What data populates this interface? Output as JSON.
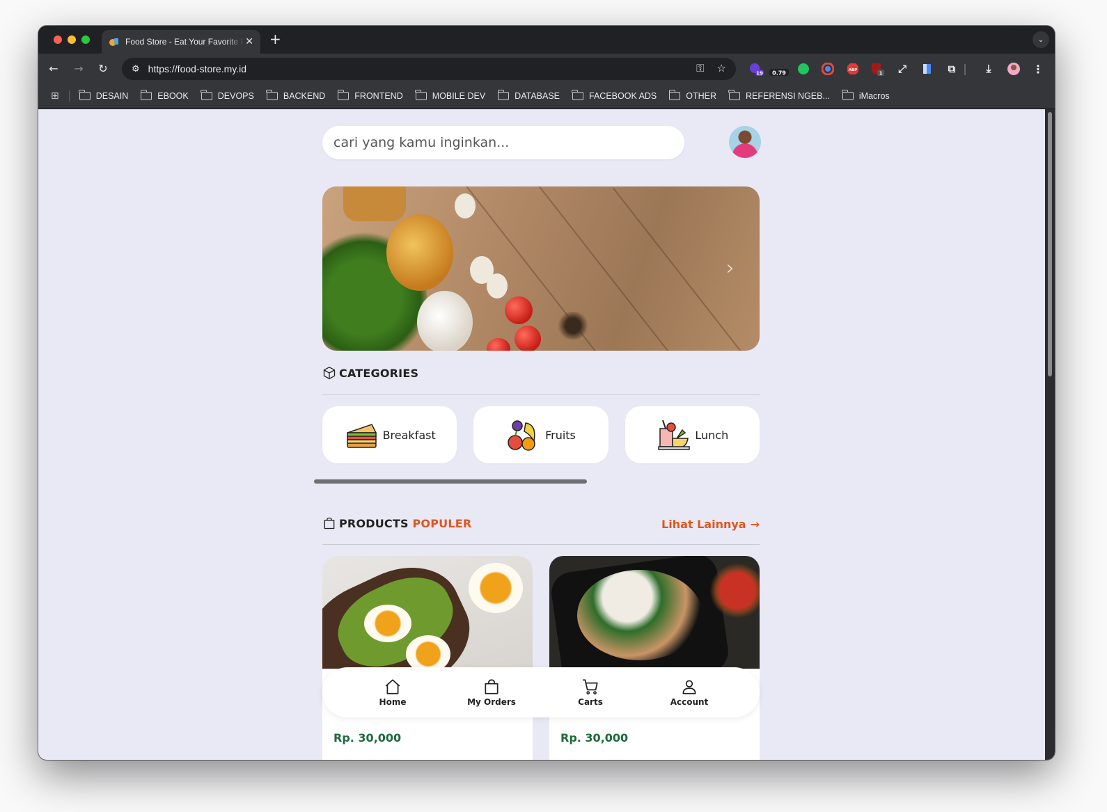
{
  "browser": {
    "tab_title": "Food Store - Eat Your Favorite Food",
    "url": "https://food-store.my.id",
    "extensions": {
      "badge_count": "19",
      "zoom_value": "0.79",
      "abp_label": "ABP",
      "ublock_badge": "1"
    },
    "bookmarks": [
      "DESAIN",
      "EBOOK",
      "DEVOPS",
      "BACKEND",
      "FRONTEND",
      "MOBILE DEV",
      "DATABASE",
      "FACEBOOK ADS",
      "OTHER",
      "REFERENSI NGEB...",
      "iMacros"
    ]
  },
  "page": {
    "search": {
      "placeholder": "cari yang kamu inginkan..."
    },
    "categories": {
      "title": "CATEGORIES",
      "items": [
        {
          "label": "Breakfast",
          "icon": "sandwich-icon"
        },
        {
          "label": "Fruits",
          "icon": "fruits-icon"
        },
        {
          "label": "Lunch",
          "icon": "lunch-icon"
        }
      ]
    },
    "products": {
      "title_part1": "PRODUCTS",
      "title_part2": "POPULER",
      "see_more": "Lihat Lainnya",
      "items": [
        {
          "price": "Rp. 30,000",
          "image": "egg-avocado-toast"
        },
        {
          "price": "Rp. 30,000",
          "image": "rice-bowl-salad"
        }
      ]
    },
    "bottom_nav": [
      {
        "label": "Home",
        "icon": "home-icon"
      },
      {
        "label": "My Orders",
        "icon": "shopping-bag-icon"
      },
      {
        "label": "Carts",
        "icon": "cart-icon"
      },
      {
        "label": "Account",
        "icon": "user-icon"
      }
    ]
  },
  "colors": {
    "accent_orange": "#e0561e",
    "price_green": "#1d6a3a",
    "page_bg": "#e9e9f6"
  }
}
